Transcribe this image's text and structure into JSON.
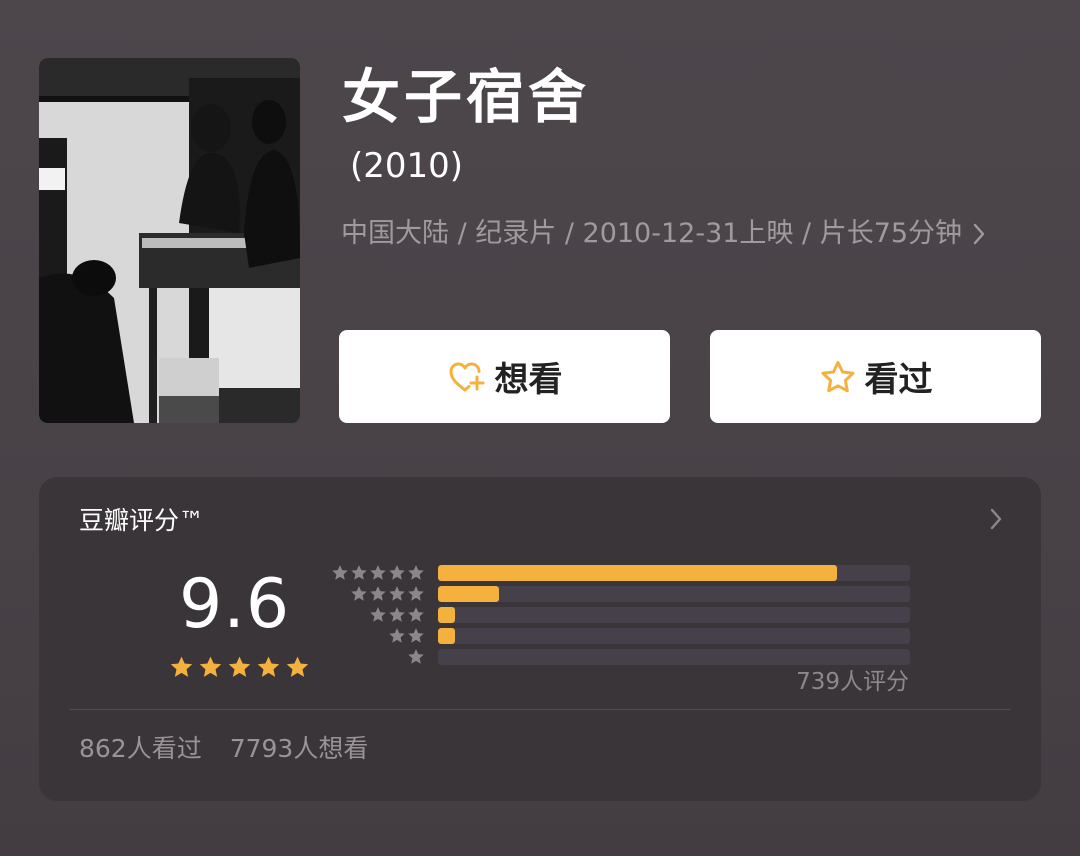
{
  "movie": {
    "title": "女子宿舍",
    "year": "(2010)",
    "meta": "中国大陆 / 纪录片 / 2010-12-31上映 / 片长75分钟",
    "poster_alt": "black-and-white documentary still"
  },
  "actions": {
    "want_label": "想看",
    "seen_label": "看过",
    "accent_color": "#f5b13d"
  },
  "rating": {
    "heading": "豆瓣评分™",
    "score": "9.6",
    "score_stars": 5,
    "raters_text": "739人评分",
    "distribution": [
      {
        "stars": 5,
        "fraction": 0.845
      },
      {
        "stars": 4,
        "fraction": 0.13
      },
      {
        "stars": 3,
        "fraction": 0.035
      },
      {
        "stars": 2,
        "fraction": 0.035
      },
      {
        "stars": 1,
        "fraction": 0.0
      }
    ],
    "seen_text": "862人看过",
    "want_text": "7793人想看"
  },
  "icons": {
    "want": "heart-plus-icon",
    "seen": "star-outline-icon",
    "chevron": "chevron-right-icon"
  }
}
